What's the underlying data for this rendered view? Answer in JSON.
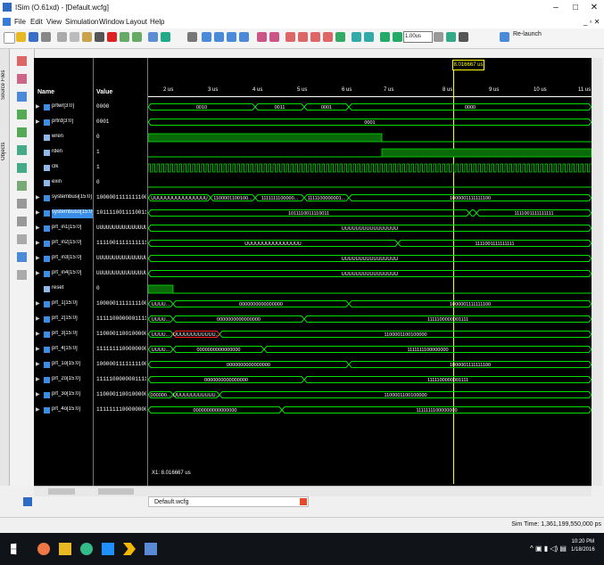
{
  "window": {
    "title": "ISim (O.61xd) - [Default.wcfg]"
  },
  "menu": [
    "File",
    "Edit",
    "View",
    "Simulation",
    "Window",
    "Layout",
    "Help"
  ],
  "toolbar": {
    "time_value": "1.00us",
    "relaunch_label": "Re-launch"
  },
  "left_tabs": [
    "Source Files",
    "Objects"
  ],
  "columns": {
    "name": "Name",
    "value": "Value"
  },
  "cursor": {
    "label": "8.016667 us",
    "x1_readout": "X1: 8.016667 us"
  },
  "timeline": [
    "2 us",
    "3 us",
    "4 us",
    "5 us",
    "6 us",
    "7 us",
    "8 us",
    "9 us",
    "10 us",
    "11 us"
  ],
  "signals": [
    {
      "name": "prtwr[3:0]",
      "value": "0000",
      "bus": true
    },
    {
      "name": "prtrd[3:0]",
      "value": "0001",
      "bus": true
    },
    {
      "name": "wren",
      "value": "0",
      "bus": false
    },
    {
      "name": "rden",
      "value": "1",
      "bus": false
    },
    {
      "name": "clk",
      "value": "1",
      "bus": false
    },
    {
      "name": "exin",
      "value": "0",
      "bus": false
    },
    {
      "name": "systembusi[15:0]",
      "value": "1000001111111100",
      "bus": true
    },
    {
      "name": "systembuso[15:0]",
      "value": "1011110011110011",
      "bus": true
    },
    {
      "name": "prt_in1[15:0]",
      "value": "UUUUUUUUUUUUUUUU",
      "bus": true
    },
    {
      "name": "prt_in2[15:0]",
      "value": "1111001111111111",
      "bus": true
    },
    {
      "name": "prt_in3[15:0]",
      "value": "UUUUUUUUUUUUUUUU",
      "bus": true
    },
    {
      "name": "prt_in4[15:0]",
      "value": "UUUUUUUUUUUUUUUU",
      "bus": true
    },
    {
      "name": "reset",
      "value": "0",
      "bus": false
    },
    {
      "name": "prt_1[15:0]",
      "value": "1000001111111100",
      "bus": true
    },
    {
      "name": "prt_2[15:0]",
      "value": "1111100000001111",
      "bus": true
    },
    {
      "name": "prt_3[15:0]",
      "value": "1100001100100000",
      "bus": true
    },
    {
      "name": "prt_4[15:0]",
      "value": "1111111100000000",
      "bus": true
    },
    {
      "name": "prt_1o[15:0]",
      "value": "1000001111111100",
      "bus": true
    },
    {
      "name": "prt_2o[15:0]",
      "value": "1111100000001111",
      "bus": true
    },
    {
      "name": "prt_3o[15:0]",
      "value": "1100001100100000",
      "bus": true
    },
    {
      "name": "prt_4o[15:0]",
      "value": "1111111100000000",
      "bus": true
    }
  ],
  "wave_labels": {
    "prtwr": [
      "0010",
      "0011",
      "0001",
      "0000"
    ],
    "prtrd": [
      "0001"
    ],
    "systembusi": [
      "UUUUUUUUUUUUUUUU",
      "1100001100100...",
      "1111111100000...",
      "1111100000001...",
      "1000001111111100"
    ],
    "systembuso": [
      "1011110011110011",
      "1111001111111111"
    ],
    "prt_in1": [
      "UUUUUUUUUUUUUUUU"
    ],
    "prt_in2": [
      "UUUUUUUUUUUUUUUU",
      "1111001111111111"
    ],
    "prt_in3": [
      "UUUUUUUUUUUUUUUU"
    ],
    "prt_in4": [
      "UUUUUUUUUUUUUUUU"
    ],
    "prt_1": [
      "UUUU...",
      "0000000000000000",
      "1000001111111100"
    ],
    "prt_2": [
      "UUUU...",
      "0000000000000000",
      "1111100000001111"
    ],
    "prt_3": [
      "UUUU...",
      "UUUUUUUUUUUU...",
      "1100001100100000"
    ],
    "prt_4": [
      "UUUU...",
      "0000000000000000",
      "1111111100000000"
    ],
    "prt_1o": [
      "0000000000000000",
      "1000001111111100"
    ],
    "prt_2o": [
      "0000000000000000",
      "1111100000001111"
    ],
    "prt_3o": [
      "000000...",
      "UUUUUUUUUUUU...",
      "1100001100100000"
    ],
    "prt_4o": [
      "0000000000000000",
      "1111111100000000"
    ]
  },
  "doc_tab": "Default.wcfg",
  "status": {
    "sim_time": "Sim Time: 1,361,199,550,000 ps"
  },
  "taskbar": {
    "time": "10:20 PM",
    "date": "1/18/2016"
  },
  "colors": {
    "wave_green": "#00e000",
    "cursor": "#ffff00",
    "bg": "#000000",
    "bus_highlight": "#3a8ee6"
  }
}
